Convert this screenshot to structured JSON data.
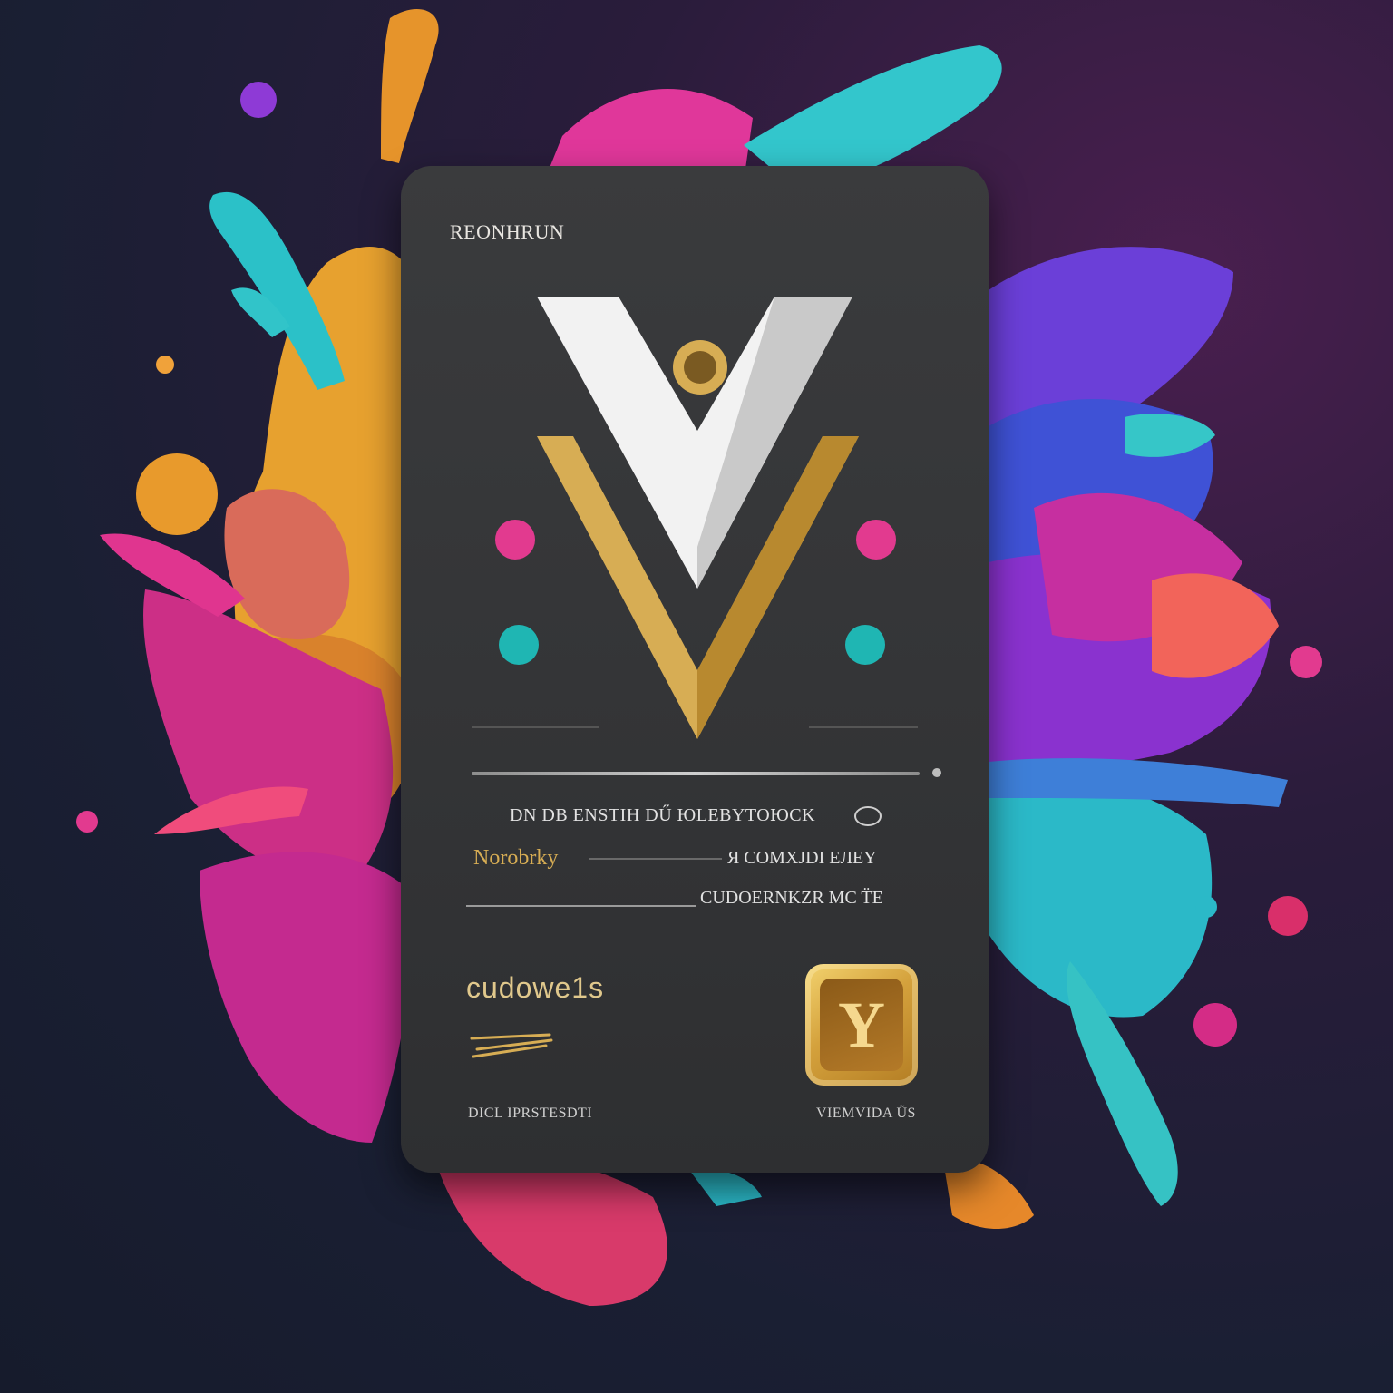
{
  "card": {
    "brand": "REONHRUN",
    "line1": "DN DB ENSTIH DŰ ЮLEBYTOЮCK",
    "line2_left": "Norobrky",
    "line2_right": "Я COMXJDI EЛEY",
    "line3_right": "CUDOERNKZR MC T̈Ε",
    "code": "cudowe1s",
    "footer_left": "DICL IPRSTESDTI",
    "footer_right": "VIEMVIDA ŨS",
    "badge_letter": "Y"
  },
  "colors": {
    "gold": "#d7ad54",
    "white": "#f3f3f3",
    "pink": "#e23a8f",
    "teal": "#1fb6b3",
    "card": "#353638"
  }
}
